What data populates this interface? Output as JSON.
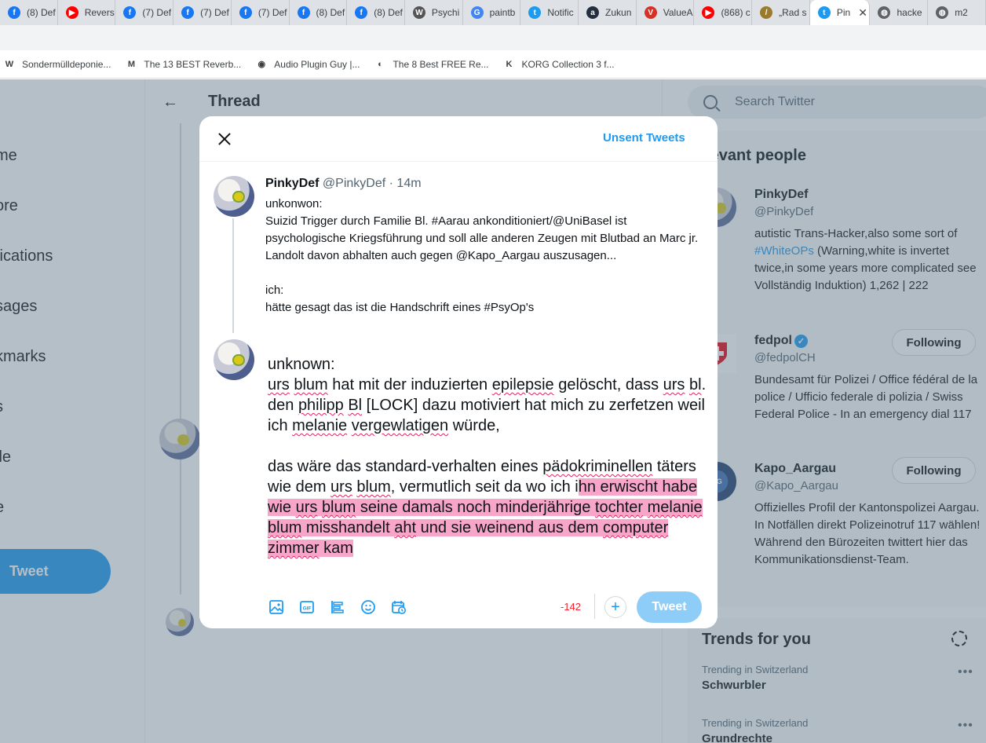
{
  "browser": {
    "tabs": [
      {
        "label": "(8) Def",
        "icon": "facebook-icon",
        "color": "#1877f2",
        "glyph": "f"
      },
      {
        "label": "Revers",
        "icon": "youtube-icon",
        "color": "#ff0000",
        "glyph": "▶"
      },
      {
        "label": "(7) Def",
        "icon": "facebook-icon",
        "color": "#1877f2",
        "glyph": "f"
      },
      {
        "label": "(7) Def",
        "icon": "facebook-icon",
        "color": "#1877f2",
        "glyph": "f"
      },
      {
        "label": "(7) Def",
        "icon": "facebook-icon",
        "color": "#1877f2",
        "glyph": "f"
      },
      {
        "label": "(8) Def",
        "icon": "facebook-icon",
        "color": "#1877f2",
        "glyph": "f"
      },
      {
        "label": "(8) Def",
        "icon": "facebook-icon",
        "color": "#1877f2",
        "glyph": "f"
      },
      {
        "label": "Psychi",
        "icon": "wikipedia-icon",
        "color": "#555555",
        "glyph": "W"
      },
      {
        "label": "paintb",
        "icon": "google-icon",
        "color": "#4285f4",
        "glyph": "G"
      },
      {
        "label": "Notific",
        "icon": "twitter-icon",
        "color": "#1d9bf0",
        "glyph": "t"
      },
      {
        "label": "Zukun",
        "icon": "amazon-icon",
        "color": "#232f3e",
        "glyph": "a"
      },
      {
        "label": "ValueA",
        "icon": "valuea-icon",
        "color": "#d93025",
        "glyph": "V"
      },
      {
        "label": "(868) c",
        "icon": "youtube-icon",
        "color": "#ff0000",
        "glyph": "▶"
      },
      {
        "label": "„Rad s",
        "icon": "pen-icon",
        "color": "#9a7b2c",
        "glyph": "/"
      },
      {
        "label": "Pin",
        "icon": "twitter-icon",
        "color": "#1d9bf0",
        "glyph": "t",
        "active": true
      },
      {
        "label": "hacke",
        "icon": "globe-icon",
        "color": "#5f6368",
        "glyph": "◍"
      },
      {
        "label": "m2",
        "icon": "globe-icon",
        "color": "#5f6368",
        "glyph": "◍"
      }
    ],
    "bookmarks": [
      {
        "label": "Sondermülldeponie...",
        "glyph": "W"
      },
      {
        "label": "The 13 BEST Reverb...",
        "glyph": "M"
      },
      {
        "label": "Audio Plugin Guy |...",
        "glyph": "◉"
      },
      {
        "label": "The 8 Best FREE Re...",
        "glyph": "◐"
      },
      {
        "label": "KORG Collection 3 f...",
        "glyph": "K"
      }
    ]
  },
  "sidebar": {
    "items": [
      "me",
      "ore",
      "fications",
      "sages",
      "kmarks",
      "s",
      "ile",
      "e"
    ],
    "tweet_button": "Tweet"
  },
  "thread": {
    "title": "Thread"
  },
  "search": {
    "placeholder": "Search Twitter"
  },
  "relevant_people": {
    "title": "elevant people",
    "people": [
      {
        "name": "PinkyDef",
        "handle": "@PinkyDef",
        "bio_before": "autistic Trans-Hacker,also some sort of ",
        "bio_hashtag": "#WhiteOPs",
        "bio_after": " (Warning,white is invertet twice,in some years more complicated see Vollständig Induktion) 1,262 | 222"
      },
      {
        "name": "fedpol",
        "handle": "@fedpolCH",
        "bio": "Bundesamt für Polizei / Office fédéral de la police / Ufficio federale di polizia / Swiss Federal Police - In an emergency dial 117",
        "button": "Following"
      },
      {
        "name": "Kapo_Aargau",
        "handle": "@Kapo_Aargau",
        "bio": "Offizielles Profil der Kantonspolizei Aargau. In Notfällen direkt Polizeinotruf 117 wählen! Während den Bürozeiten twittert hier das Kommunikationsdienst-Team.",
        "button": "Following"
      }
    ]
  },
  "trends": {
    "title": "Trends for you",
    "items": [
      {
        "meta": "Trending in Switzerland",
        "name": "Schwurbler"
      },
      {
        "meta": "Trending in Switzerland",
        "name": "Grundrechte"
      }
    ]
  },
  "modal": {
    "unsent_label": "Unsent Tweets",
    "quoted": {
      "name": "PinkyDef",
      "handle": "@PinkyDef",
      "sep": "·",
      "time": "14m",
      "lines": [
        "unkonwon:",
        "Suizid Trigger durch Familie Bl. #Aarau ankonditioniert/@UniBasel ist psychologische Kriegsführung und soll alle anderen Zeugen mit Blutbad an Marc jr. Landolt davon abhalten auch gegen @Kapo_Aargau auszusagen...",
        "",
        "ich:",
        "hätte gesagt das ist die Handschrift eines #PsyOp's"
      ]
    },
    "compose": {
      "line1": "unknown:",
      "para1": {
        "s1": "urs",
        "s2": " ",
        "s3": "blum",
        "s4": " hat mit der induzierten ",
        "s5": "epilepsie",
        "s6": " gelöscht, dass ",
        "s7": "urs",
        "s8": " ",
        "s9": "bl",
        "s10": ". den ",
        "s11": "philipp",
        "s12": " ",
        "s13": "Bl",
        "s14": " [LOCK] dazu motiviert hat mich zu zerfetzen weil ich ",
        "s15": "melanie",
        "s16": " ",
        "s17": "vergewlatigen",
        "s18": " würde,"
      },
      "para2": {
        "t1": "das wäre das standard-verhalten eines ",
        "t2": "pädokriminellen",
        "t3": " täters wie dem ",
        "t4": "urs",
        "t5": " ",
        "t6": "blum",
        "t7": ", vermutlich seit da wo ich i",
        "h1": "hn erwischt habe wie ",
        "h2": "urs",
        "h3": " ",
        "h4": "blum",
        "h5": " seine damals noch minderjährige ",
        "h6": "tochter",
        "h7": " ",
        "h8": "melanie",
        "h9": " ",
        "h10": "blum",
        "h11": " misshandelt ",
        "h12": "aht",
        "h13": " und sie weinend aus dem ",
        "h14": "computer",
        "h15": " ",
        "h16": "zimmer",
        "h17": " kam"
      }
    },
    "counter": "-142",
    "add_label": "+",
    "tweet_label": "Tweet"
  }
}
